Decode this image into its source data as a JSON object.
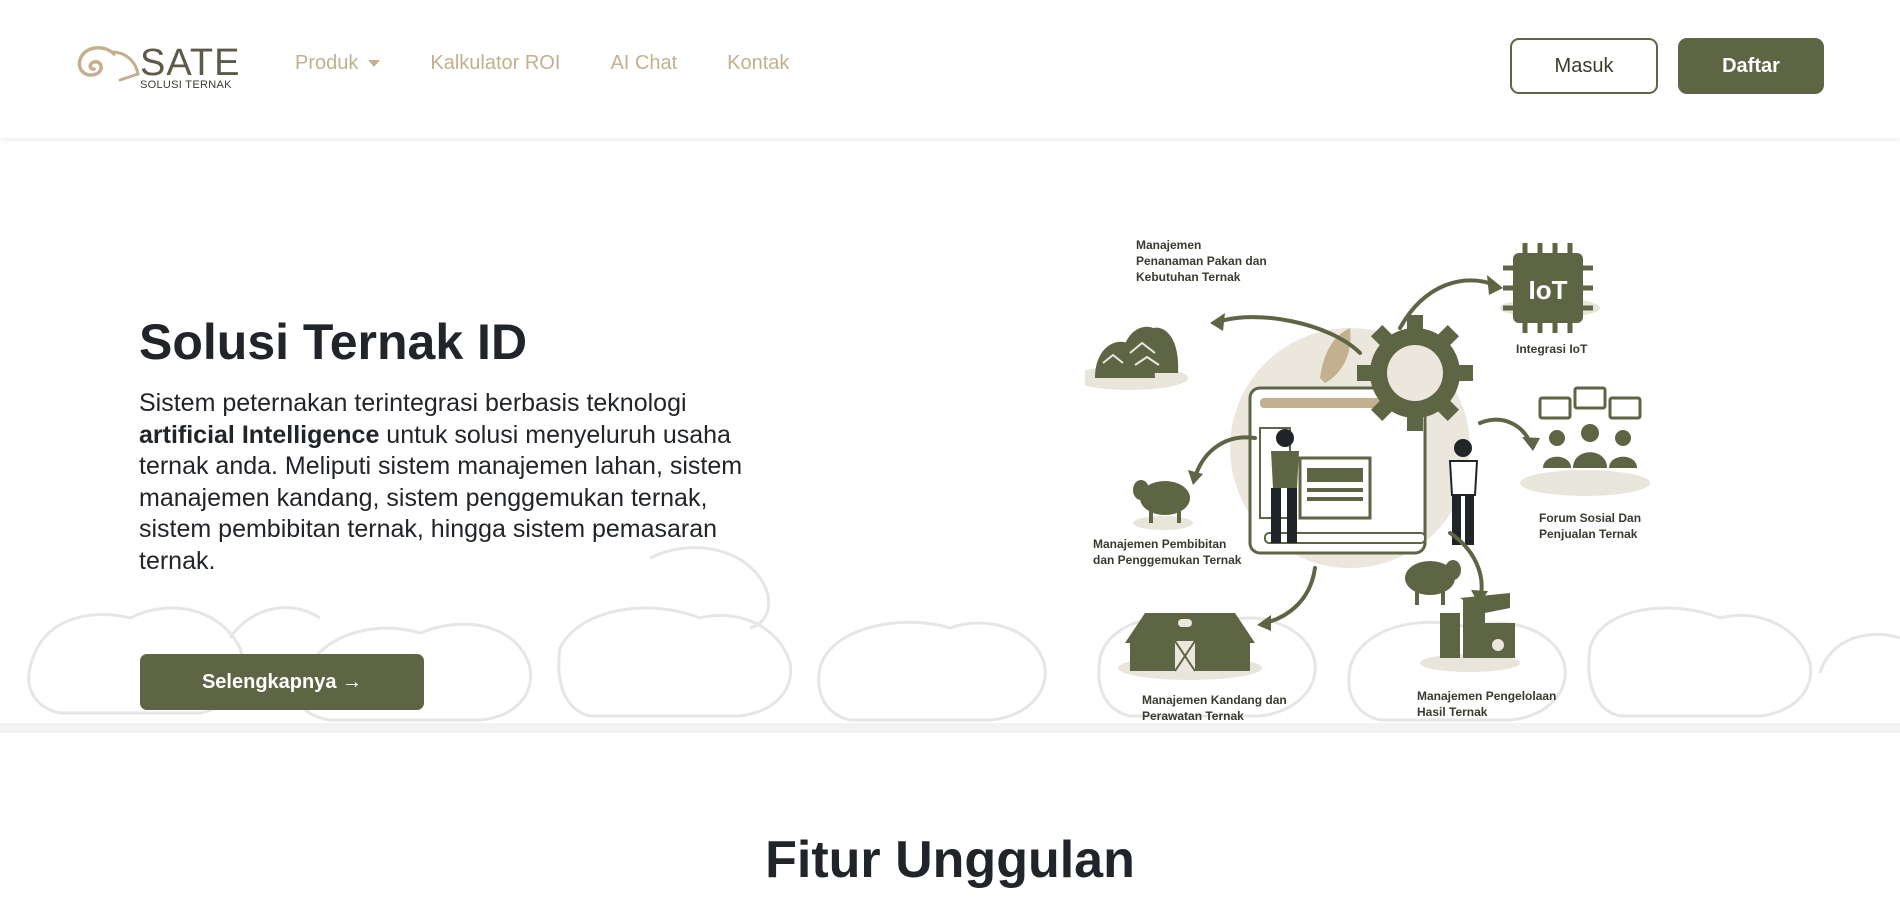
{
  "brand": {
    "name": "SATE",
    "tagline": "SOLUSI TERNAK",
    "primary_color": "#5e6545",
    "accent_color": "#c3b08e"
  },
  "nav": {
    "items": [
      {
        "label": "Produk",
        "icon": "chevron-down-icon"
      },
      {
        "label": "Kalkulator ROI"
      },
      {
        "label": "AI Chat"
      },
      {
        "label": "Kontak"
      }
    ],
    "login_label": "Masuk",
    "register_label": "Daftar"
  },
  "hero": {
    "title": "Solusi Ternak ID",
    "desc_part1": "Sistem peternakan terintegrasi berbasis teknologi ",
    "desc_bold": "artificial Intelligence",
    "desc_part2": " untuk solusi menyeluruh usaha ternak anda. Meliputi sistem manajemen lahan, sistem manajemen kandang, sistem penggemukan ternak, sistem pembibitan ternak, hingga sistem pemasaran ternak.",
    "cta_label": "Selengkapnya →"
  },
  "illustration": {
    "labels": {
      "pakan": "Manajemen\nPenanaman Pakan dan\nKebutuhan Ternak",
      "iot": "Integrasi IoT",
      "iot_chip": "IoT",
      "forum": "Forum Sosial Dan\nPenjualan Ternak",
      "pembibitan": "Manajemen Pembibitan\ndan Penggemukan Ternak",
      "kandang": "Manajemen Kandang dan\nPerawatan Ternak",
      "hasil": "Manajemen Pengelolaan\nHasil Ternak"
    }
  },
  "features": {
    "title_bold": "Fitur",
    "title_rest": " Unggulan"
  }
}
